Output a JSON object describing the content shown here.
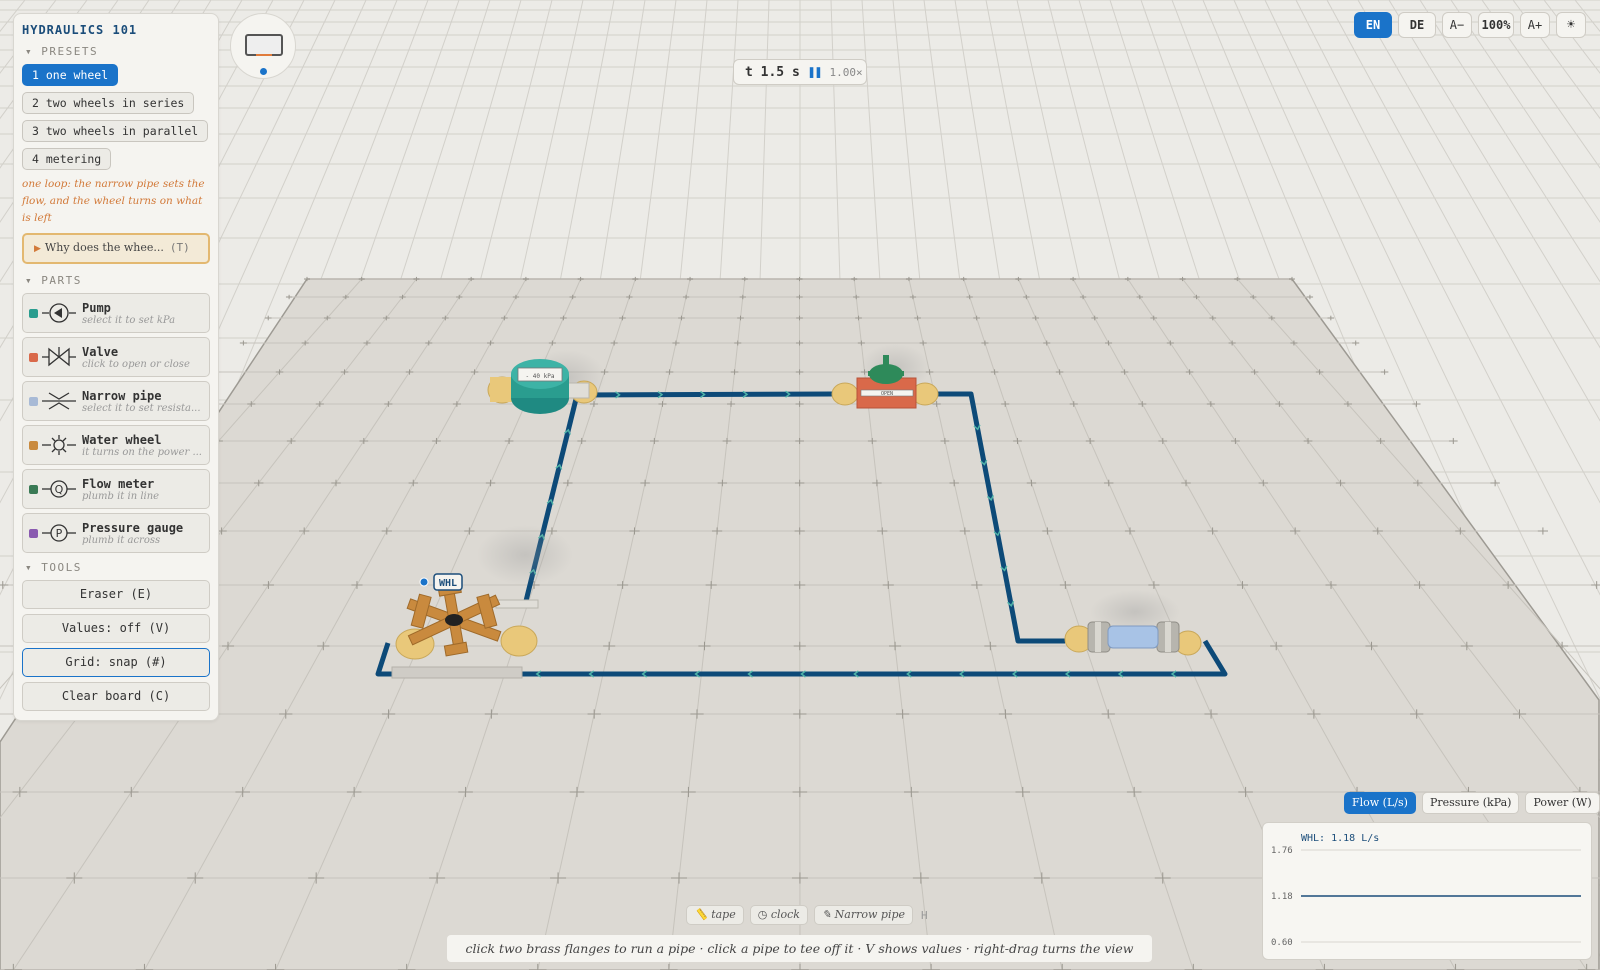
{
  "app": {
    "title": "HYDRAULICS 101"
  },
  "sidebar": {
    "presets_heading": "▾ PRESETS",
    "presets": [
      {
        "label": "1 one wheel",
        "active": true
      },
      {
        "label": "2 two wheels in series",
        "active": false
      },
      {
        "label": "3 two wheels in parallel",
        "active": false
      },
      {
        "label": "4 metering",
        "active": false
      }
    ],
    "hint": "one loop: the narrow pipe sets the flow, and the wheel turns on what is left",
    "why": {
      "label": "Why does the whee...",
      "key": "(T)"
    },
    "parts_heading": "▾ PARTS",
    "parts": [
      {
        "name": "Pump",
        "desc": "select it to set kPa",
        "color": "#2a9d8f",
        "icon": "pump-icon"
      },
      {
        "name": "Valve",
        "desc": "click to open or close",
        "color": "#d9694a",
        "icon": "valve-icon"
      },
      {
        "name": "Narrow pipe",
        "desc": "select it to set resista...",
        "color": "#a8bad6",
        "icon": "narrow-pipe-icon"
      },
      {
        "name": "Water wheel",
        "desc": "it turns on the power ...",
        "color": "#c98a3e",
        "icon": "water-wheel-icon"
      },
      {
        "name": "Flow meter",
        "desc": "plumb it in line",
        "color": "#3a7a55",
        "icon": "flow-meter-icon"
      },
      {
        "name": "Pressure gauge",
        "desc": "plumb it across",
        "color": "#8a5ab0",
        "icon": "pressure-gauge-icon"
      }
    ],
    "tools_heading": "▾ TOOLS",
    "tools": [
      {
        "label": "Eraser  (E)",
        "active": false
      },
      {
        "label": "Values: off  (V)",
        "active": false
      },
      {
        "label": "Grid: snap  (#)",
        "active": true
      },
      {
        "label": "Clear board  (C)",
        "active": false
      }
    ]
  },
  "time": {
    "label": "t 1.5 s",
    "pause": "❚❚",
    "speed": "1.00×"
  },
  "topbar": {
    "lang_en": "EN",
    "lang_de": "DE",
    "zoom_out": "A−",
    "zoom": "100%",
    "zoom_in": "A+",
    "theme_icon": "sun-icon"
  },
  "board": {
    "wheel_tag": "WHL",
    "valve_label": "OPEN",
    "pump_label": "- 40 kPa"
  },
  "chart_tabs": [
    "Flow (L/s)",
    "Pressure (kPa)",
    "Power (W)"
  ],
  "chart_data": {
    "type": "line",
    "title": "WHL: 1.18 L/s",
    "ylim": [
      0.6,
      1.76
    ],
    "yticks": [
      "1.76",
      "1.18",
      "0.60"
    ],
    "series": [
      {
        "name": "WHL",
        "values": [
          1.18,
          1.18
        ]
      }
    ]
  },
  "bottom": {
    "chips": [
      "📏 tape",
      "◷ clock",
      "✎ Narrow pipe"
    ],
    "key": "H",
    "hint": "click two brass flanges to run a pipe · click a pipe to tee off it · V shows values · right-drag turns the view"
  },
  "colors": {
    "accent": "#1a73c9",
    "pipe": "#0d4a78",
    "flow": "#4fb3a8"
  }
}
